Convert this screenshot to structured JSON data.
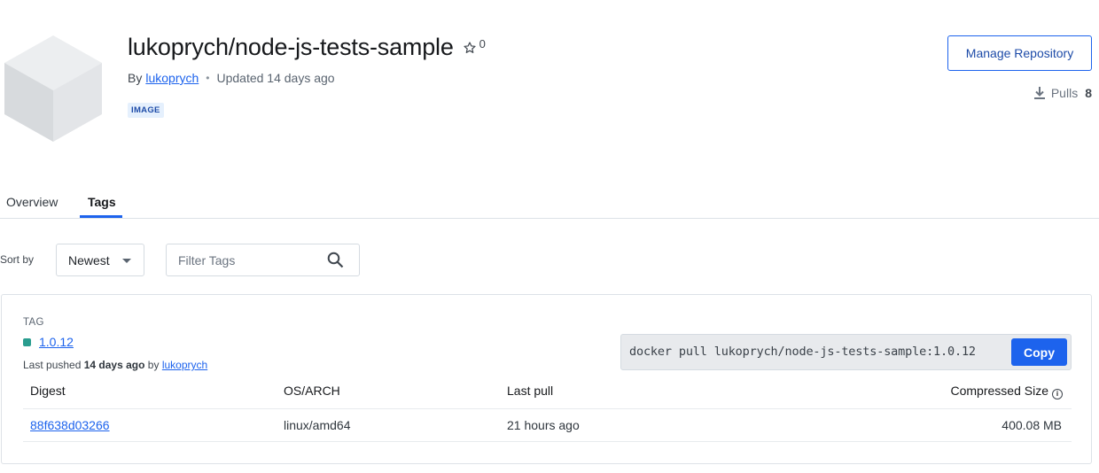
{
  "repo": {
    "title": "lukoprych/node-js-tests-sample",
    "stars": "0",
    "by_label": "By",
    "owner": "lukoprych",
    "updated": "Updated 14 days ago",
    "badge": "IMAGE"
  },
  "actions": {
    "manage_label": "Manage Repository",
    "pulls_label": "Pulls",
    "pulls_count": "8"
  },
  "tabs": [
    {
      "label": "Overview",
      "active": false
    },
    {
      "label": "Tags",
      "active": true
    }
  ],
  "controls": {
    "sort_label": "Sort by",
    "sort_value": "Newest",
    "filter_placeholder": "Filter Tags"
  },
  "tag": {
    "header": "TAG",
    "name": "1.0.12",
    "pushed_prefix": "Last pushed",
    "pushed_time": "14 days ago",
    "pushed_by": "by",
    "pushed_user": "lukoprych",
    "pull_command": "docker pull lukoprych/node-js-tests-sample:1.0.12",
    "copy_label": "Copy"
  },
  "table": {
    "headers": {
      "digest": "Digest",
      "os_arch": "OS/ARCH",
      "last_pull": "Last pull",
      "size": "Compressed Size"
    },
    "rows": [
      {
        "digest": "88f638d03266",
        "os_arch": "linux/amd64",
        "last_pull": "21 hours ago",
        "size": "400.08 MB"
      }
    ]
  },
  "colors": {
    "accent": "#1d63ed",
    "tag_dot": "#2a9d8f",
    "badge_bg": "#e5f0fd"
  }
}
